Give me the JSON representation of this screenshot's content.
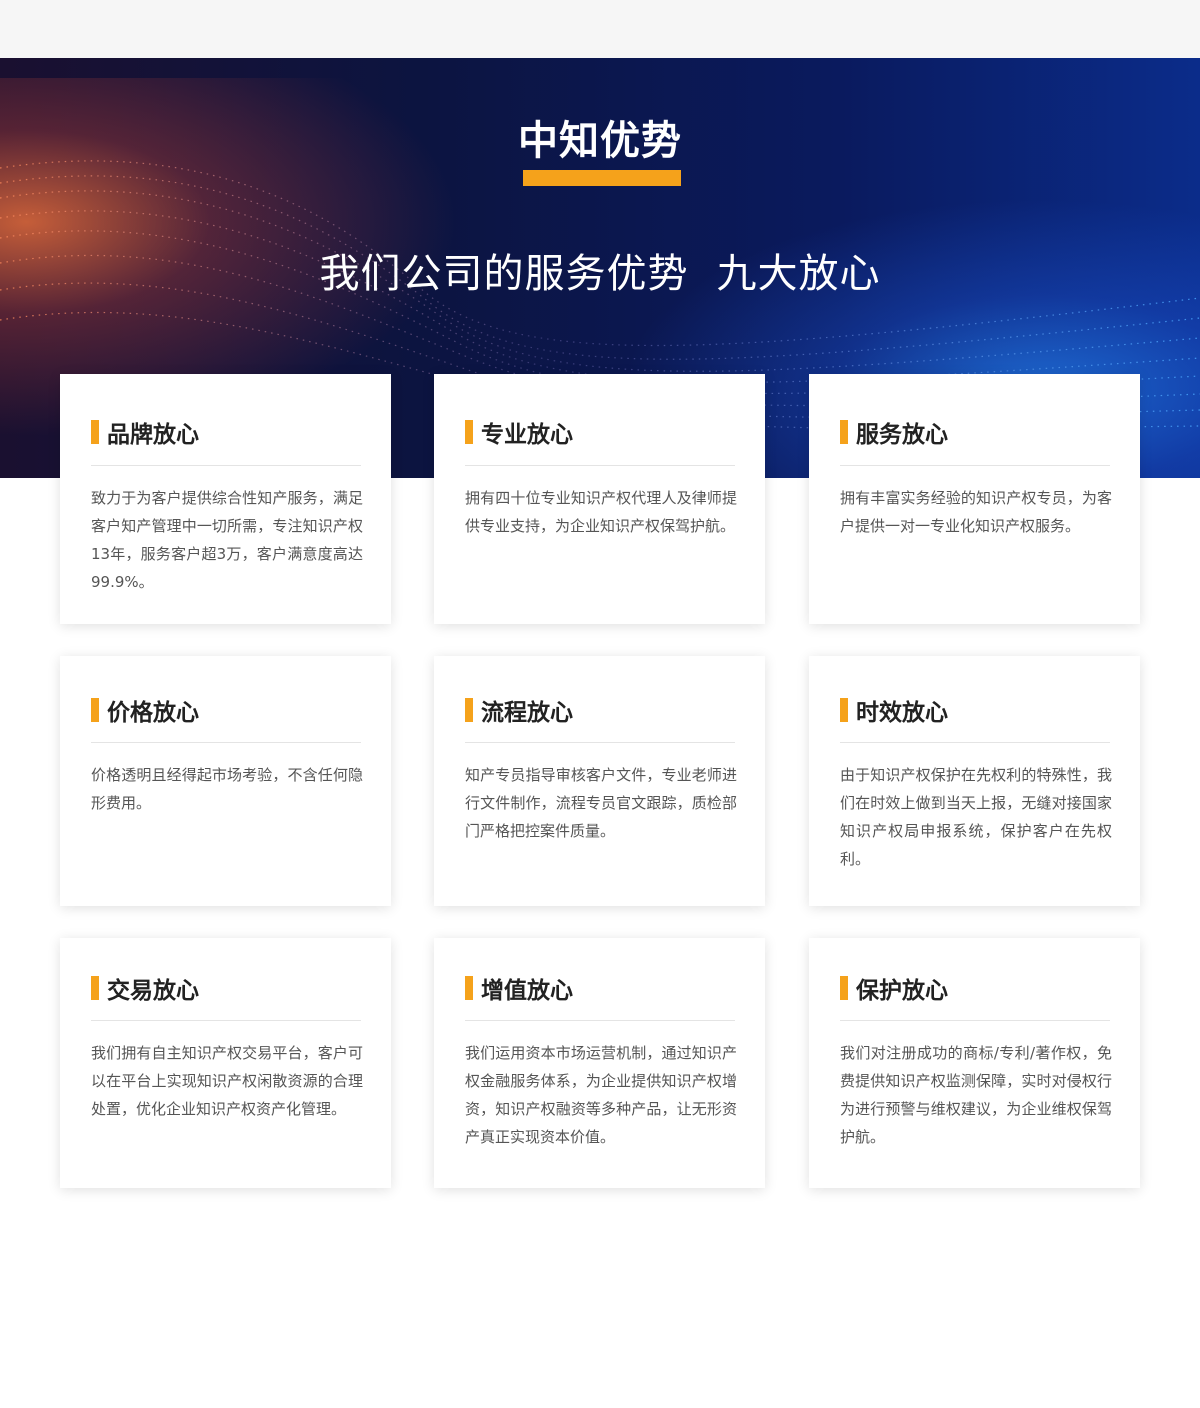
{
  "hero": {
    "title": "中知优势",
    "subtitle_main": "我们公司的服务优势",
    "subtitle_tail": "九大放心"
  },
  "cards": [
    {
      "title": "品牌放心",
      "text": "致力于为客户提供综合性知产服务，满足客户知产管理中一切所需，专注知识产权13年，服务客户超3万，客户满意度高达 99.9%。"
    },
    {
      "title": "专业放心",
      "text": "拥有四十位专业知识产权代理人及律师提供专业支持，为企业知识产权保驾护航。"
    },
    {
      "title": "服务放心",
      "text": "拥有丰富实务经验的知识产权专员，为客户提供一对一专业化知识产权服务。"
    },
    {
      "title": "价格放心",
      "text": "价格透明且经得起市场考验，不含任何隐形费用。"
    },
    {
      "title": "流程放心",
      "text": "知产专员指导审核客户文件，专业老师进行文件制作，流程专员官文跟踪，质检部门严格把控案件质量。"
    },
    {
      "title": "时效放心",
      "text": "由于知识产权保护在先权利的特殊性，我们在时效上做到当天上报，无缝对接国家知识产权局申报系统，保护客户在先权利。"
    },
    {
      "title": "交易放心",
      "text": "我们拥有自主知识产权交易平台，客户可以在平台上实现知识产权闲散资源的合理处置，优化企业知识产权资产化管理。"
    },
    {
      "title": "增值放心",
      "text": "我们运用资本市场运营机制，通过知识产权金融服务体系，为企业提供知识产权增资，知识产权融资等多种产品，让无形资产真正实现资本价值。"
    },
    {
      "title": "保护放心",
      "text": "我们对注册成功的商标/专利/著作权，免费提供知识产权监测保障，实时对侵权行为进行预警与维权建议，为企业维权保驾护航。"
    }
  ],
  "colors": {
    "accent": "#f5a21b",
    "title_text": "#222222",
    "body_text": "#555555"
  }
}
